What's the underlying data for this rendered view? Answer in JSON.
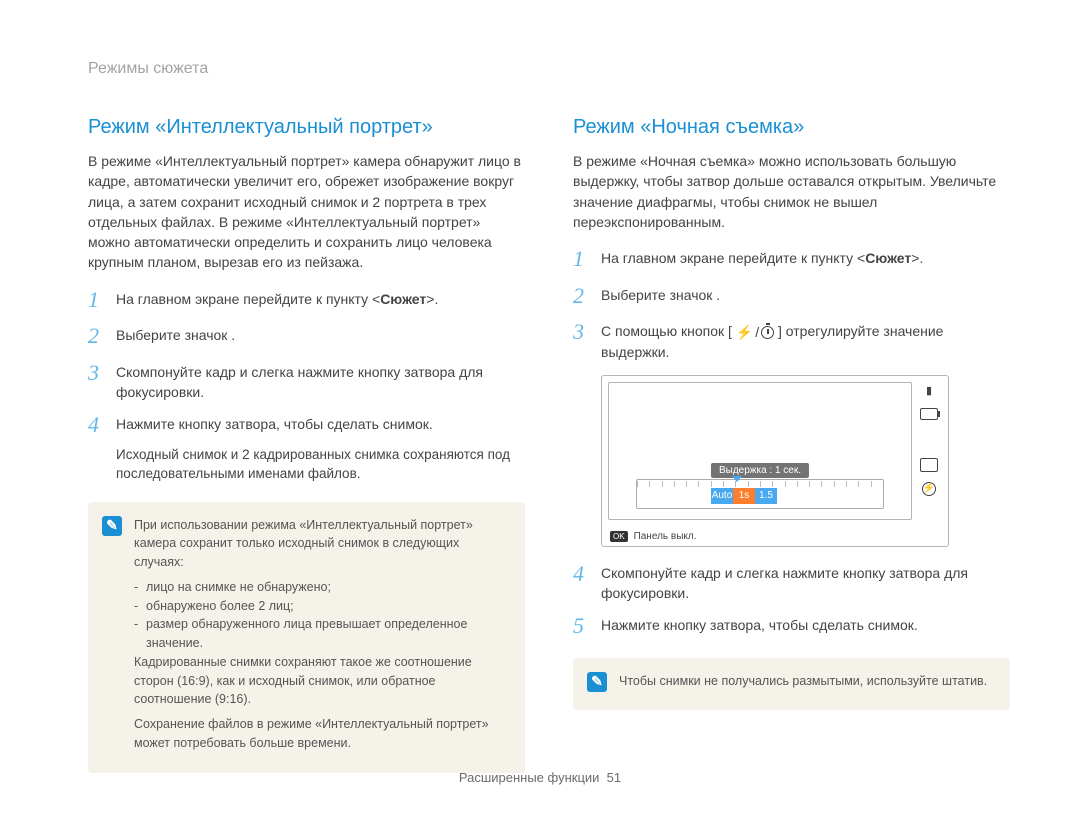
{
  "header": {
    "breadcrumb": "Режимы сюжета"
  },
  "left": {
    "title": "Режим «Интеллектуальный портрет»",
    "intro": "В режиме «Интеллектуальный портрет» камера обнаружит лицо в кадре, автоматически увеличит его, обрежет изображение вокруг лица, а затем сохранит исходный снимок и 2 портрета в трех отдельных файлах. В режиме «Интеллектуальный портрет» можно автоматически определить и сохранить лицо человека крупным планом, вырезав его из пейзажа.",
    "steps": [
      {
        "n": "1",
        "pre": "На главном экране перейдите к пункту <",
        "bold": "Сюжет",
        "post": ">."
      },
      {
        "n": "2",
        "text": "Выберите значок        ."
      },
      {
        "n": "3",
        "text": "Скомпонуйте кадр и слегка нажмите кнопку затвора для фокусировки."
      },
      {
        "n": "4",
        "text": "Нажмите кнопку затвора, чтобы сделать снимок."
      }
    ],
    "substep": "Исходный снимок и 2 кадрированных снимка сохраняются под последовательными именами файлов.",
    "note": {
      "p1": "При использовании режима «Интеллектуальный портрет» камера сохранит только исходный снимок в следующих случаях:",
      "li1": "лицо на снимке не обнаружено;",
      "li2": "обнаружено более 2 лиц;",
      "li3": "размер обнаруженного лица превышает определенное значение.",
      "p2": "Кадрированные снимки сохраняют такое же соотношение сторон (16:9), как и исходный снимок, или обратное соотношение (9:16).",
      "p3": "Сохранение файлов в режиме «Интеллектуальный портрет» может потребовать больше времени."
    }
  },
  "right": {
    "title": "Режим «Ночная съемка»",
    "intro": "В режиме «Ночная съемка» можно использовать большую выдержку, чтобы затвор дольше оставался открытым. Увеличьте значение диафрагмы, чтобы снимок не вышел переэкспонированным.",
    "steps_a": [
      {
        "n": "1",
        "pre": "На главном экране перейдите к пункту <",
        "bold": "Сюжет",
        "post": ">."
      },
      {
        "n": "2",
        "text": "Выберите значок        ."
      },
      {
        "n": "3",
        "pre": "С помощью кнопок [",
        "post": "] отрегулируйте значение выдержки."
      }
    ],
    "preview": {
      "overlay": "Выдержка : 1 сек.",
      "slider": {
        "a": "Auto",
        "b": "1s",
        "c": "1.5"
      },
      "ok": "OK",
      "footer": "Панель выкл."
    },
    "steps_b": [
      {
        "n": "4",
        "text": "Скомпонуйте кадр и слегка нажмите кнопку затвора для фокусировки."
      },
      {
        "n": "5",
        "text": "Нажмите кнопку затвора, чтобы сделать снимок."
      }
    ],
    "note": "Чтобы снимки не получались размытыми, используйте штатив."
  },
  "footer": {
    "section": "Расширенные функции",
    "page": "51"
  }
}
